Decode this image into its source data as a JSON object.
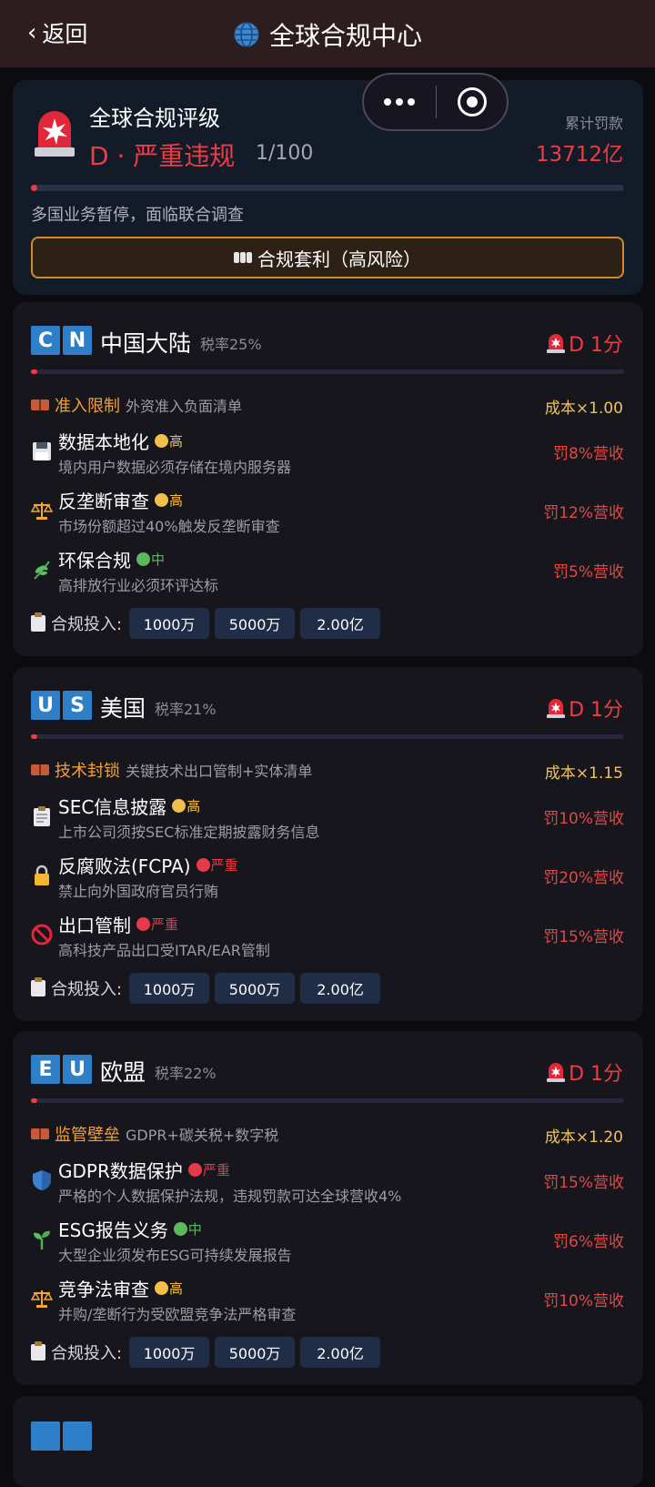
{
  "nav": {
    "back": "返回",
    "title": "全球合规中心",
    "colors": {
      "bg": "#2e1d1e"
    }
  },
  "summary": {
    "title": "全球合规评级",
    "grade": "D · 严重违规",
    "score": "1/100",
    "score_fraction": 0.01,
    "fine_label": "累计罚款",
    "fine": "13712亿",
    "status": "多国业务暂停，面临联合调查",
    "button": "合规套利（高风险）"
  },
  "cards": [
    {
      "flag": [
        "C",
        "N"
      ],
      "name": "中国大陆",
      "tax": "税率25%",
      "grade": "D 1分",
      "barrier": {
        "name": "准入限制",
        "desc": "外资准入负面清单",
        "cost": "成本×1.00"
      },
      "items": [
        {
          "icon": "floppy-disk-icon",
          "name": "数据本地化",
          "level": "高",
          "level_color": "#f2c04a",
          "desc": "境内用户数据必须存储在境内服务器",
          "fine": "罚8%营收"
        },
        {
          "icon": "scales-icon",
          "name": "反垄断审查",
          "level": "高",
          "level_color": "#f2c04a",
          "desc": "市场份额超过40%触发反垄断审查",
          "fine": "罚12%营收"
        },
        {
          "icon": "herb-icon",
          "name": "环保合规",
          "level": "中",
          "level_color": "#5cb85c",
          "desc": "高排放行业必须环评达标",
          "fine": "罚5%营收"
        }
      ],
      "invest_label": "合规投入:",
      "invest": [
        "1000万",
        "5000万",
        "2.00亿"
      ]
    },
    {
      "flag": [
        "U",
        "S"
      ],
      "name": "美国",
      "tax": "税率21%",
      "grade": "D 1分",
      "barrier": {
        "name": "技术封锁",
        "desc": "关键技术出口管制+实体清单",
        "cost": "成本×1.15"
      },
      "items": [
        {
          "icon": "clipboard-icon",
          "name": "SEC信息披露",
          "level": "高",
          "level_color": "#f2c04a",
          "desc": "上市公司须按SEC标准定期披露财务信息",
          "fine": "罚10%营收"
        },
        {
          "icon": "lock-icon",
          "name": "反腐败法(FCPA)",
          "level": "严重",
          "level_color": "#e43a4a",
          "desc": "禁止向外国政府官员行贿",
          "fine": "罚20%营收"
        },
        {
          "icon": "prohibited-icon",
          "name": "出口管制",
          "level": "严重",
          "level_color": "#e43a4a",
          "desc": "高科技产品出口受ITAR/EAR管制",
          "fine": "罚15%营收"
        }
      ],
      "invest_label": "合规投入:",
      "invest": [
        "1000万",
        "5000万",
        "2.00亿"
      ]
    },
    {
      "flag": [
        "E",
        "U"
      ],
      "name": "欧盟",
      "tax": "税率22%",
      "grade": "D 1分",
      "barrier": {
        "name": "监管壁垒",
        "desc": "GDPR+碳关税+数字税",
        "cost": "成本×1.20"
      },
      "items": [
        {
          "icon": "shield-icon",
          "name": "GDPR数据保护",
          "level": "严重",
          "level_color": "#e43a4a",
          "desc": "严格的个人数据保护法规，违规罚款可达全球营收4%",
          "fine": "罚15%营收"
        },
        {
          "icon": "seedling-icon",
          "name": "ESG报告义务",
          "level": "中",
          "level_color": "#5cb85c",
          "desc": "大型企业须发布ESG可持续发展报告",
          "fine": "罚6%营收"
        },
        {
          "icon": "scales-icon",
          "name": "竞争法审查",
          "level": "高",
          "level_color": "#f2c04a",
          "desc": "并购/垄断行为受欧盟竞争法严格审查",
          "fine": "罚10%营收"
        }
      ],
      "invest_label": "合规投入:",
      "invest": [
        "1000万",
        "5000万",
        "2.00亿"
      ]
    }
  ],
  "colors": {
    "danger": "#ee3b44",
    "warning": "#f2a035",
    "card_bg": "#17161d",
    "page_bg": "#0c0b10",
    "flag_blue": "#2f7fc8"
  }
}
